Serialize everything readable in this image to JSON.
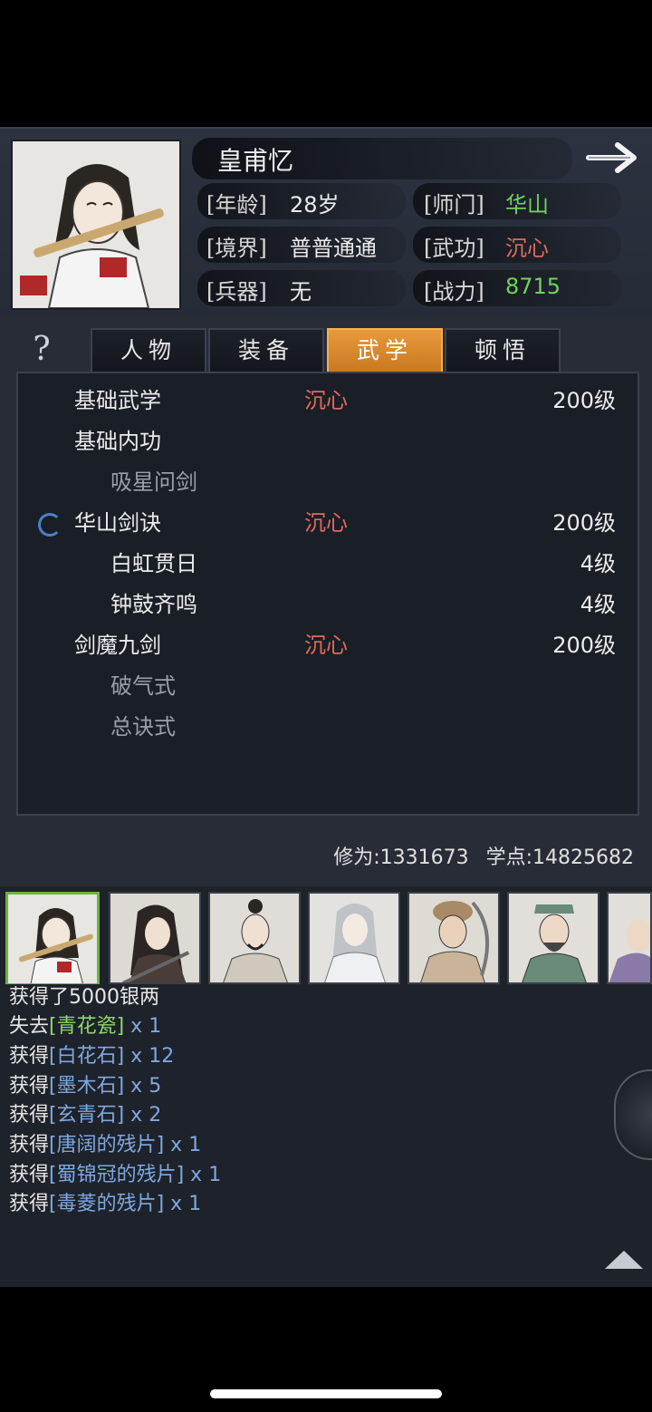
{
  "character": {
    "name": "皇甫忆",
    "stats": {
      "age_label": "[年龄]",
      "age_value": "28岁",
      "sect_label": "[师门]",
      "sect_value": "华山",
      "realm_label": "[境界]",
      "realm_value": "普普通通",
      "martial_label": "[武功]",
      "martial_value": "沉心",
      "weapon_label": "[兵器]",
      "weapon_value": "无",
      "power_label": "[战力]",
      "power_value": "8715"
    }
  },
  "tabs": [
    {
      "label": "人物",
      "active": false
    },
    {
      "label": "装备",
      "active": false
    },
    {
      "label": "武学",
      "active": true
    },
    {
      "label": "顿悟",
      "active": false
    }
  ],
  "help_label": "?",
  "skills": [
    {
      "name": "基础武学",
      "state": "沉心",
      "level": "200级"
    },
    {
      "name": "基础内功",
      "state": "",
      "level": ""
    },
    {
      "name": "吸星问剑",
      "state": "",
      "level": ""
    },
    {
      "name": "华山剑诀",
      "state": "沉心",
      "level": "200级"
    },
    {
      "name": "白虹贯日",
      "state": "",
      "level": "4级"
    },
    {
      "name": "钟鼓齐鸣",
      "state": "",
      "level": "4级"
    },
    {
      "name": "剑魔九剑",
      "state": "沉心",
      "level": "200级"
    },
    {
      "name": "破气式",
      "state": "",
      "level": ""
    },
    {
      "name": "总诀式",
      "state": "",
      "level": ""
    }
  ],
  "points": {
    "cultivation": "修为:1331673",
    "study": "学点:14825682"
  },
  "log": [
    {
      "prefix": "获得了5000银两",
      "item": "",
      "qty": ""
    },
    {
      "prefix": "失去",
      "item": "[青花瓷]",
      "qty": " x 1"
    },
    {
      "prefix": "获得",
      "item": "[白花石]",
      "qty": " x 12"
    },
    {
      "prefix": "获得",
      "item": "[墨木石]",
      "qty": " x 5"
    },
    {
      "prefix": "获得",
      "item": "[玄青石]",
      "qty": " x 2"
    },
    {
      "prefix": "获得",
      "item": "[唐阔的残片]",
      "qty": " x 1"
    },
    {
      "prefix": "获得",
      "item": "[蜀锦冠的残片]",
      "qty": " x 1"
    },
    {
      "prefix": "获得",
      "item": "[毒菱的残片]",
      "qty": " x 1"
    }
  ],
  "colors": {
    "accent_orange": "#e89a3c",
    "state_red": "#e06a5c",
    "green": "#6fd35c",
    "item_blue": "#7fa8e0"
  }
}
